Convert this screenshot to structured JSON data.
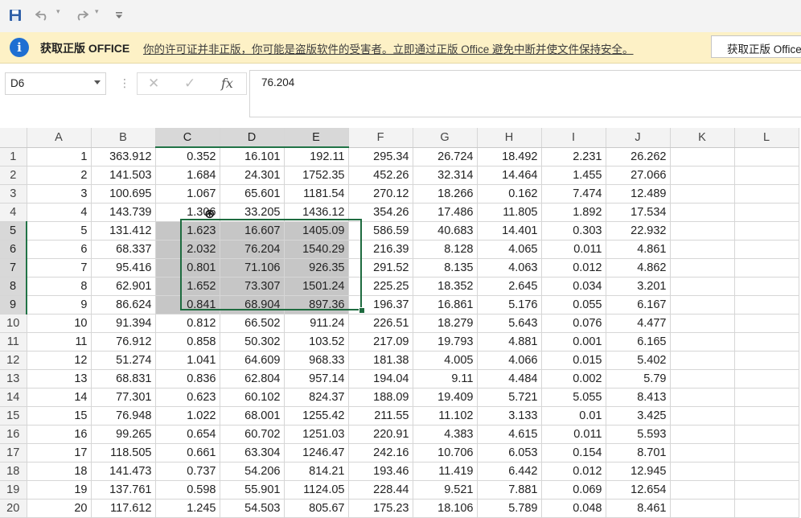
{
  "toolbar": {
    "save_icon": "save-icon",
    "undo_icon": "undo-icon",
    "redo_icon": "redo-icon",
    "customize_icon": "customize-toolbar-icon"
  },
  "message_bar": {
    "icon": "info-icon",
    "title": "获取正版 OFFICE",
    "text": "你的许可证并非正版，你可能是盗版软件的受害者。立即通过正版 Office 避免中断并使文件保持安全。",
    "button_label": "获取正版 Office"
  },
  "formula_bar": {
    "name_box": "D6",
    "formula": "76.204"
  },
  "columns": [
    "",
    "A",
    "B",
    "C",
    "D",
    "E",
    "F",
    "G",
    "H",
    "I",
    "J",
    "K",
    "L"
  ],
  "rows": [
    {
      "n": "1",
      "cells": [
        "1",
        "363.912",
        "0.352",
        "16.101",
        "192.11",
        "295.34",
        "26.724",
        "18.492",
        "2.231",
        "26.262"
      ]
    },
    {
      "n": "2",
      "cells": [
        "2",
        "141.503",
        "1.684",
        "24.301",
        "1752.35",
        "452.26",
        "32.314",
        "14.464",
        "1.455",
        "27.066"
      ]
    },
    {
      "n": "3",
      "cells": [
        "3",
        "100.695",
        "1.067",
        "65.601",
        "1181.54",
        "270.12",
        "18.266",
        "0.162",
        "7.474",
        "12.489"
      ]
    },
    {
      "n": "4",
      "cells": [
        "4",
        "143.739",
        "1.306",
        "33.205",
        "1436.12",
        "354.26",
        "17.486",
        "11.805",
        "1.892",
        "17.534"
      ]
    },
    {
      "n": "5",
      "cells": [
        "5",
        "131.412",
        "1.623",
        "16.607",
        "1405.09",
        "586.59",
        "40.683",
        "14.401",
        "0.303",
        "22.932"
      ]
    },
    {
      "n": "6",
      "cells": [
        "6",
        "68.337",
        "2.032",
        "76.204",
        "1540.29",
        "216.39",
        "8.128",
        "4.065",
        "0.011",
        "4.861"
      ]
    },
    {
      "n": "7",
      "cells": [
        "7",
        "95.416",
        "0.801",
        "71.106",
        "926.35",
        "291.52",
        "8.135",
        "4.063",
        "0.012",
        "4.862"
      ]
    },
    {
      "n": "8",
      "cells": [
        "8",
        "62.901",
        "1.652",
        "73.307",
        "1501.24",
        "225.25",
        "18.352",
        "2.645",
        "0.034",
        "3.201"
      ]
    },
    {
      "n": "9",
      "cells": [
        "9",
        "86.624",
        "0.841",
        "68.904",
        "897.36",
        "196.37",
        "16.861",
        "5.176",
        "0.055",
        "6.167"
      ]
    },
    {
      "n": "10",
      "cells": [
        "10",
        "91.394",
        "0.812",
        "66.502",
        "911.24",
        "226.51",
        "18.279",
        "5.643",
        "0.076",
        "4.477"
      ]
    },
    {
      "n": "11",
      "cells": [
        "11",
        "76.912",
        "0.858",
        "50.302",
        "103.52",
        "217.09",
        "19.793",
        "4.881",
        "0.001",
        "6.165"
      ]
    },
    {
      "n": "12",
      "cells": [
        "12",
        "51.274",
        "1.041",
        "64.609",
        "968.33",
        "181.38",
        "4.005",
        "4.066",
        "0.015",
        "5.402"
      ]
    },
    {
      "n": "13",
      "cells": [
        "13",
        "68.831",
        "0.836",
        "62.804",
        "957.14",
        "194.04",
        "9.11",
        "4.484",
        "0.002",
        "5.79"
      ]
    },
    {
      "n": "14",
      "cells": [
        "14",
        "77.301",
        "0.623",
        "60.102",
        "824.37",
        "188.09",
        "19.409",
        "5.721",
        "5.055",
        "8.413"
      ]
    },
    {
      "n": "15",
      "cells": [
        "15",
        "76.948",
        "1.022",
        "68.001",
        "1255.42",
        "211.55",
        "11.102",
        "3.133",
        "0.01",
        "3.425"
      ]
    },
    {
      "n": "16",
      "cells": [
        "16",
        "99.265",
        "0.654",
        "60.702",
        "1251.03",
        "220.91",
        "4.383",
        "4.615",
        "0.011",
        "5.593"
      ]
    },
    {
      "n": "17",
      "cells": [
        "17",
        "118.505",
        "0.661",
        "63.304",
        "1246.47",
        "242.16",
        "10.706",
        "6.053",
        "0.154",
        "8.701"
      ]
    },
    {
      "n": "18",
      "cells": [
        "18",
        "141.473",
        "0.737",
        "54.206",
        "814.21",
        "193.46",
        "11.419",
        "6.442",
        "0.012",
        "12.945"
      ]
    },
    {
      "n": "19",
      "cells": [
        "19",
        "137.761",
        "0.598",
        "55.901",
        "1124.05",
        "228.44",
        "9.521",
        "7.881",
        "0.069",
        "12.654"
      ]
    },
    {
      "n": "20",
      "cells": [
        "20",
        "117.612",
        "1.245",
        "54.503",
        "805.67",
        "175.23",
        "18.106",
        "5.789",
        "0.048",
        "8.461"
      ]
    }
  ],
  "selection": {
    "columns": [
      "C",
      "D",
      "E"
    ],
    "rows": [
      "5",
      "6",
      "7",
      "8",
      "9"
    ],
    "active_cell": "D6"
  },
  "colors": {
    "accent": "#217346",
    "message_bar": "#fdf1c6",
    "info_icon": "#1f6fd2",
    "selection_fill": "#c6c6c6"
  }
}
